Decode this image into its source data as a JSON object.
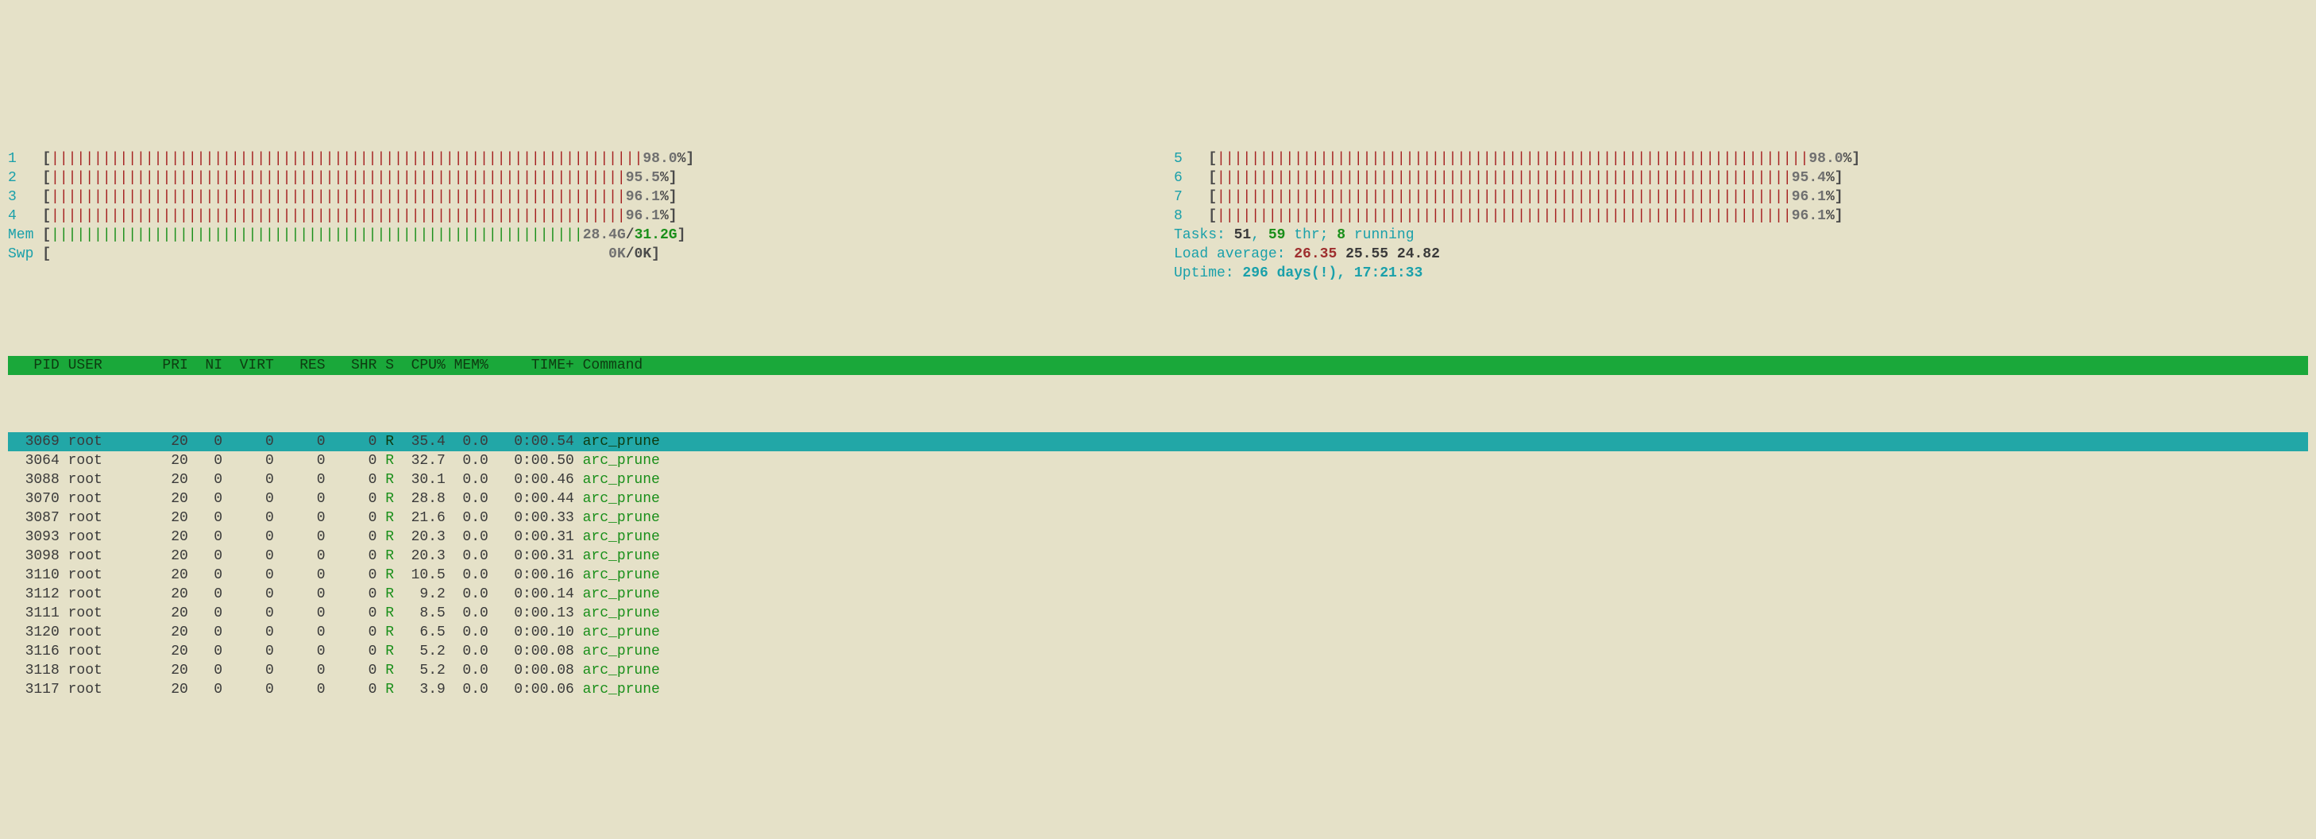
{
  "cpu_left": [
    {
      "label": "1",
      "pct": "98.0"
    },
    {
      "label": "2",
      "pct": "95.5"
    },
    {
      "label": "3",
      "pct": "96.1"
    },
    {
      "label": "4",
      "pct": "96.1"
    }
  ],
  "cpu_right": [
    {
      "label": "5",
      "pct": "98.0"
    },
    {
      "label": "6",
      "pct": "95.4"
    },
    {
      "label": "7",
      "pct": "96.1"
    },
    {
      "label": "8",
      "pct": "96.1"
    }
  ],
  "mem": {
    "label": "Mem",
    "used": "28.4G",
    "total": "31.2G"
  },
  "swp": {
    "label": "Swp",
    "used": "0K",
    "total": "0K"
  },
  "tasks": {
    "label": "Tasks:",
    "tasks": "51",
    "threads_n": "59",
    "threads_lbl": "thr;",
    "running_n": "8",
    "running_lbl": "running"
  },
  "load": {
    "label": "Load average:",
    "one": "26.35",
    "five": "25.55",
    "fifteen": "24.82"
  },
  "uptime": {
    "label": "Uptime:",
    "value": "296 days(!), 17:21:33"
  },
  "columns": {
    "pid": "PID",
    "user": "USER",
    "pri": "PRI",
    "ni": "NI",
    "virt": "VIRT",
    "res": "RES",
    "shr": "SHR",
    "s": "S",
    "cpu": "CPU%",
    "mem": "MEM%",
    "time": "TIME+",
    "cmd": "Command"
  },
  "processes": [
    {
      "pid": "3069",
      "user": "root",
      "pri": "20",
      "ni": "0",
      "virt": "0",
      "res": "0",
      "shr": "0",
      "s": "R",
      "cpu": "35.4",
      "mem": "0.0",
      "time": "0:00.54",
      "cmd": "arc_prune",
      "selected": true
    },
    {
      "pid": "3064",
      "user": "root",
      "pri": "20",
      "ni": "0",
      "virt": "0",
      "res": "0",
      "shr": "0",
      "s": "R",
      "cpu": "32.7",
      "mem": "0.0",
      "time": "0:00.50",
      "cmd": "arc_prune"
    },
    {
      "pid": "3088",
      "user": "root",
      "pri": "20",
      "ni": "0",
      "virt": "0",
      "res": "0",
      "shr": "0",
      "s": "R",
      "cpu": "30.1",
      "mem": "0.0",
      "time": "0:00.46",
      "cmd": "arc_prune"
    },
    {
      "pid": "3070",
      "user": "root",
      "pri": "20",
      "ni": "0",
      "virt": "0",
      "res": "0",
      "shr": "0",
      "s": "R",
      "cpu": "28.8",
      "mem": "0.0",
      "time": "0:00.44",
      "cmd": "arc_prune"
    },
    {
      "pid": "3087",
      "user": "root",
      "pri": "20",
      "ni": "0",
      "virt": "0",
      "res": "0",
      "shr": "0",
      "s": "R",
      "cpu": "21.6",
      "mem": "0.0",
      "time": "0:00.33",
      "cmd": "arc_prune"
    },
    {
      "pid": "3093",
      "user": "root",
      "pri": "20",
      "ni": "0",
      "virt": "0",
      "res": "0",
      "shr": "0",
      "s": "R",
      "cpu": "20.3",
      "mem": "0.0",
      "time": "0:00.31",
      "cmd": "arc_prune"
    },
    {
      "pid": "3098",
      "user": "root",
      "pri": "20",
      "ni": "0",
      "virt": "0",
      "res": "0",
      "shr": "0",
      "s": "R",
      "cpu": "20.3",
      "mem": "0.0",
      "time": "0:00.31",
      "cmd": "arc_prune"
    },
    {
      "pid": "3110",
      "user": "root",
      "pri": "20",
      "ni": "0",
      "virt": "0",
      "res": "0",
      "shr": "0",
      "s": "R",
      "cpu": "10.5",
      "mem": "0.0",
      "time": "0:00.16",
      "cmd": "arc_prune"
    },
    {
      "pid": "3112",
      "user": "root",
      "pri": "20",
      "ni": "0",
      "virt": "0",
      "res": "0",
      "shr": "0",
      "s": "R",
      "cpu": "9.2",
      "mem": "0.0",
      "time": "0:00.14",
      "cmd": "arc_prune"
    },
    {
      "pid": "3111",
      "user": "root",
      "pri": "20",
      "ni": "0",
      "virt": "0",
      "res": "0",
      "shr": "0",
      "s": "R",
      "cpu": "8.5",
      "mem": "0.0",
      "time": "0:00.13",
      "cmd": "arc_prune"
    },
    {
      "pid": "3120",
      "user": "root",
      "pri": "20",
      "ni": "0",
      "virt": "0",
      "res": "0",
      "shr": "0",
      "s": "R",
      "cpu": "6.5",
      "mem": "0.0",
      "time": "0:00.10",
      "cmd": "arc_prune"
    },
    {
      "pid": "3116",
      "user": "root",
      "pri": "20",
      "ni": "0",
      "virt": "0",
      "res": "0",
      "shr": "0",
      "s": "R",
      "cpu": "5.2",
      "mem": "0.0",
      "time": "0:00.08",
      "cmd": "arc_prune"
    },
    {
      "pid": "3118",
      "user": "root",
      "pri": "20",
      "ni": "0",
      "virt": "0",
      "res": "0",
      "shr": "0",
      "s": "R",
      "cpu": "5.2",
      "mem": "0.0",
      "time": "0:00.08",
      "cmd": "arc_prune"
    },
    {
      "pid": "3117",
      "user": "root",
      "pri": "20",
      "ni": "0",
      "virt": "0",
      "res": "0",
      "shr": "0",
      "s": "R",
      "cpu": "3.9",
      "mem": "0.0",
      "time": "0:00.06",
      "cmd": "arc_prune"
    }
  ]
}
